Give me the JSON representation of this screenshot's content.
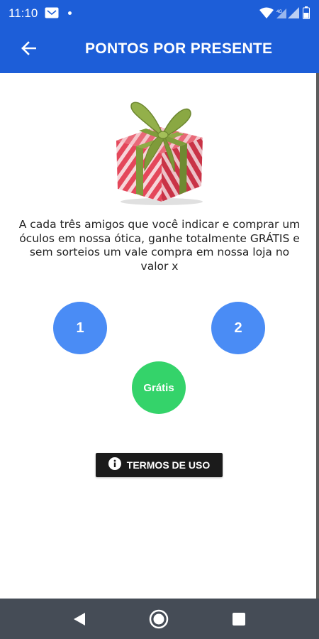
{
  "status_bar": {
    "time": "11:10",
    "icons": [
      "mail-icon",
      "dot-icon",
      "wifi-icon",
      "signal-icon",
      "signal-icon",
      "battery-icon"
    ]
  },
  "app_bar": {
    "title": "PONTOS POR PRESENTE",
    "back_icon": "arrow-left-icon",
    "color": "#1d5ed8"
  },
  "main": {
    "image": "gift-box",
    "description": "A cada três amigos que você indicar e comprar um óculos em nossa ótica, ganhe totalmente GRÁTIS e sem sorteios um vale compra em nossa loja no valor x",
    "steps": [
      {
        "label": "1",
        "color": "#4a8cf5"
      },
      {
        "label": "2",
        "color": "#4a8cf5"
      },
      {
        "label": "Grátis",
        "color": "#34d36a"
      }
    ],
    "terms_button": {
      "icon": "info-icon",
      "label": "TERMOS DE USO"
    }
  },
  "nav_bar": {
    "buttons": [
      "back-triangle-icon",
      "home-circle-icon",
      "recents-square-icon"
    ]
  }
}
